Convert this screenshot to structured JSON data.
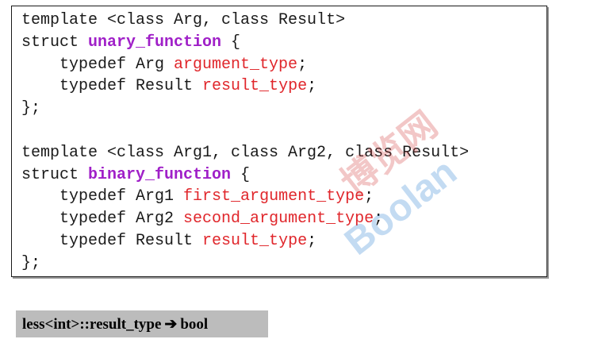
{
  "code": {
    "lines": [
      [
        {
          "t": "template <class Arg, class Result>",
          "c": "plain"
        }
      ],
      [
        {
          "t": "struct ",
          "c": "plain"
        },
        {
          "t": "unary_function",
          "c": "name"
        },
        {
          "t": " {",
          "c": "plain"
        }
      ],
      [
        {
          "t": "    typedef Arg ",
          "c": "plain"
        },
        {
          "t": "argument_type",
          "c": "member"
        },
        {
          "t": ";",
          "c": "plain"
        }
      ],
      [
        {
          "t": "    typedef Result ",
          "c": "plain"
        },
        {
          "t": "result_type",
          "c": "member"
        },
        {
          "t": ";",
          "c": "plain"
        }
      ],
      [
        {
          "t": "};",
          "c": "plain"
        }
      ],
      [
        {
          "t": "",
          "c": "plain"
        }
      ],
      [
        {
          "t": "template <class Arg1, class Arg2, class Result>",
          "c": "plain"
        }
      ],
      [
        {
          "t": "struct ",
          "c": "plain"
        },
        {
          "t": "binary_function",
          "c": "name"
        },
        {
          "t": " {",
          "c": "plain"
        }
      ],
      [
        {
          "t": "    typedef Arg1 ",
          "c": "plain"
        },
        {
          "t": "first_argument_type",
          "c": "member"
        },
        {
          "t": ";",
          "c": "plain"
        }
      ],
      [
        {
          "t": "    typedef Arg2 ",
          "c": "plain"
        },
        {
          "t": "second_argument_type",
          "c": "member"
        },
        {
          "t": ";",
          "c": "plain"
        }
      ],
      [
        {
          "t": "    typedef Result ",
          "c": "plain"
        },
        {
          "t": "result_type",
          "c": "member"
        },
        {
          "t": ";",
          "c": "plain"
        }
      ],
      [
        {
          "t": "};",
          "c": "plain"
        }
      ]
    ]
  },
  "note": {
    "left": "less<int>::result_type",
    "arrow": "➔",
    "right": "bool"
  },
  "watermark": {
    "logo_text": "Boolan",
    "cn_text": "博览网"
  },
  "colors": {
    "name": "#a020c8",
    "member": "#e0262b",
    "note_bg": "#bcbcbc"
  }
}
